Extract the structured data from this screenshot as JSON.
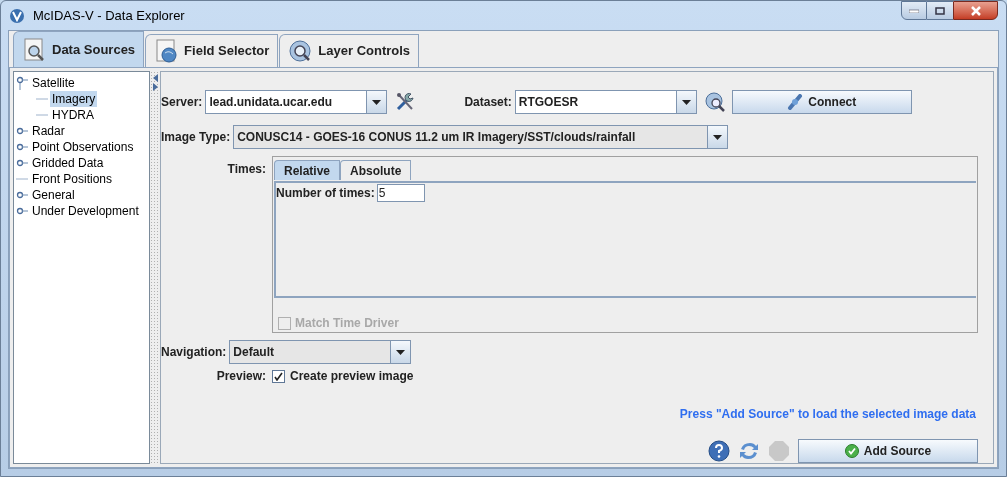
{
  "window": {
    "title": "McIDAS-V - Data Explorer"
  },
  "tabs": [
    {
      "label": "Data Sources",
      "selected": true
    },
    {
      "label": "Field Selector",
      "selected": false
    },
    {
      "label": "Layer Controls",
      "selected": false
    }
  ],
  "tree": [
    {
      "label": "Satellite",
      "kind": "folder",
      "expanded": true,
      "selected": false,
      "children": [
        {
          "label": "Imagery",
          "kind": "leaf",
          "selected": true
        },
        {
          "label": "HYDRA",
          "kind": "leaf",
          "selected": false
        }
      ]
    },
    {
      "label": "Radar",
      "kind": "folder",
      "expanded": false,
      "selected": false
    },
    {
      "label": "Point Observations",
      "kind": "folder",
      "expanded": false,
      "selected": false
    },
    {
      "label": "Gridded Data",
      "kind": "folder",
      "expanded": false,
      "selected": false
    },
    {
      "label": "Front Positions",
      "kind": "leaf",
      "selected": false
    },
    {
      "label": "General",
      "kind": "folder",
      "expanded": false,
      "selected": false
    },
    {
      "label": "Under Development",
      "kind": "folder",
      "expanded": false,
      "selected": false
    }
  ],
  "server": {
    "label": "Server:",
    "value": "lead.unidata.ucar.edu"
  },
  "dataset": {
    "label": "Dataset:",
    "value": "RTGOESR"
  },
  "connect_button": "Connect",
  "image_type": {
    "label": "Image Type:",
    "value": "CONUSC14 - GOES-16 CONUS 11.2 um IR Imagery/SST/clouds/rainfall"
  },
  "times": {
    "label": "Times:",
    "tabs": [
      {
        "label": "Relative",
        "selected": true
      },
      {
        "label": "Absolute",
        "selected": false
      }
    ],
    "count_label": "Number of times:",
    "count_value": "5",
    "match_time_driver": {
      "label": "Match Time Driver",
      "checked": false,
      "disabled": true
    }
  },
  "navigation": {
    "label": "Navigation:",
    "value": "Default"
  },
  "preview": {
    "label": "Preview:",
    "option": "Create preview image",
    "checked": true
  },
  "hint": "Press \"Add Source\" to load the selected image data",
  "add_source_button": "Add Source"
}
